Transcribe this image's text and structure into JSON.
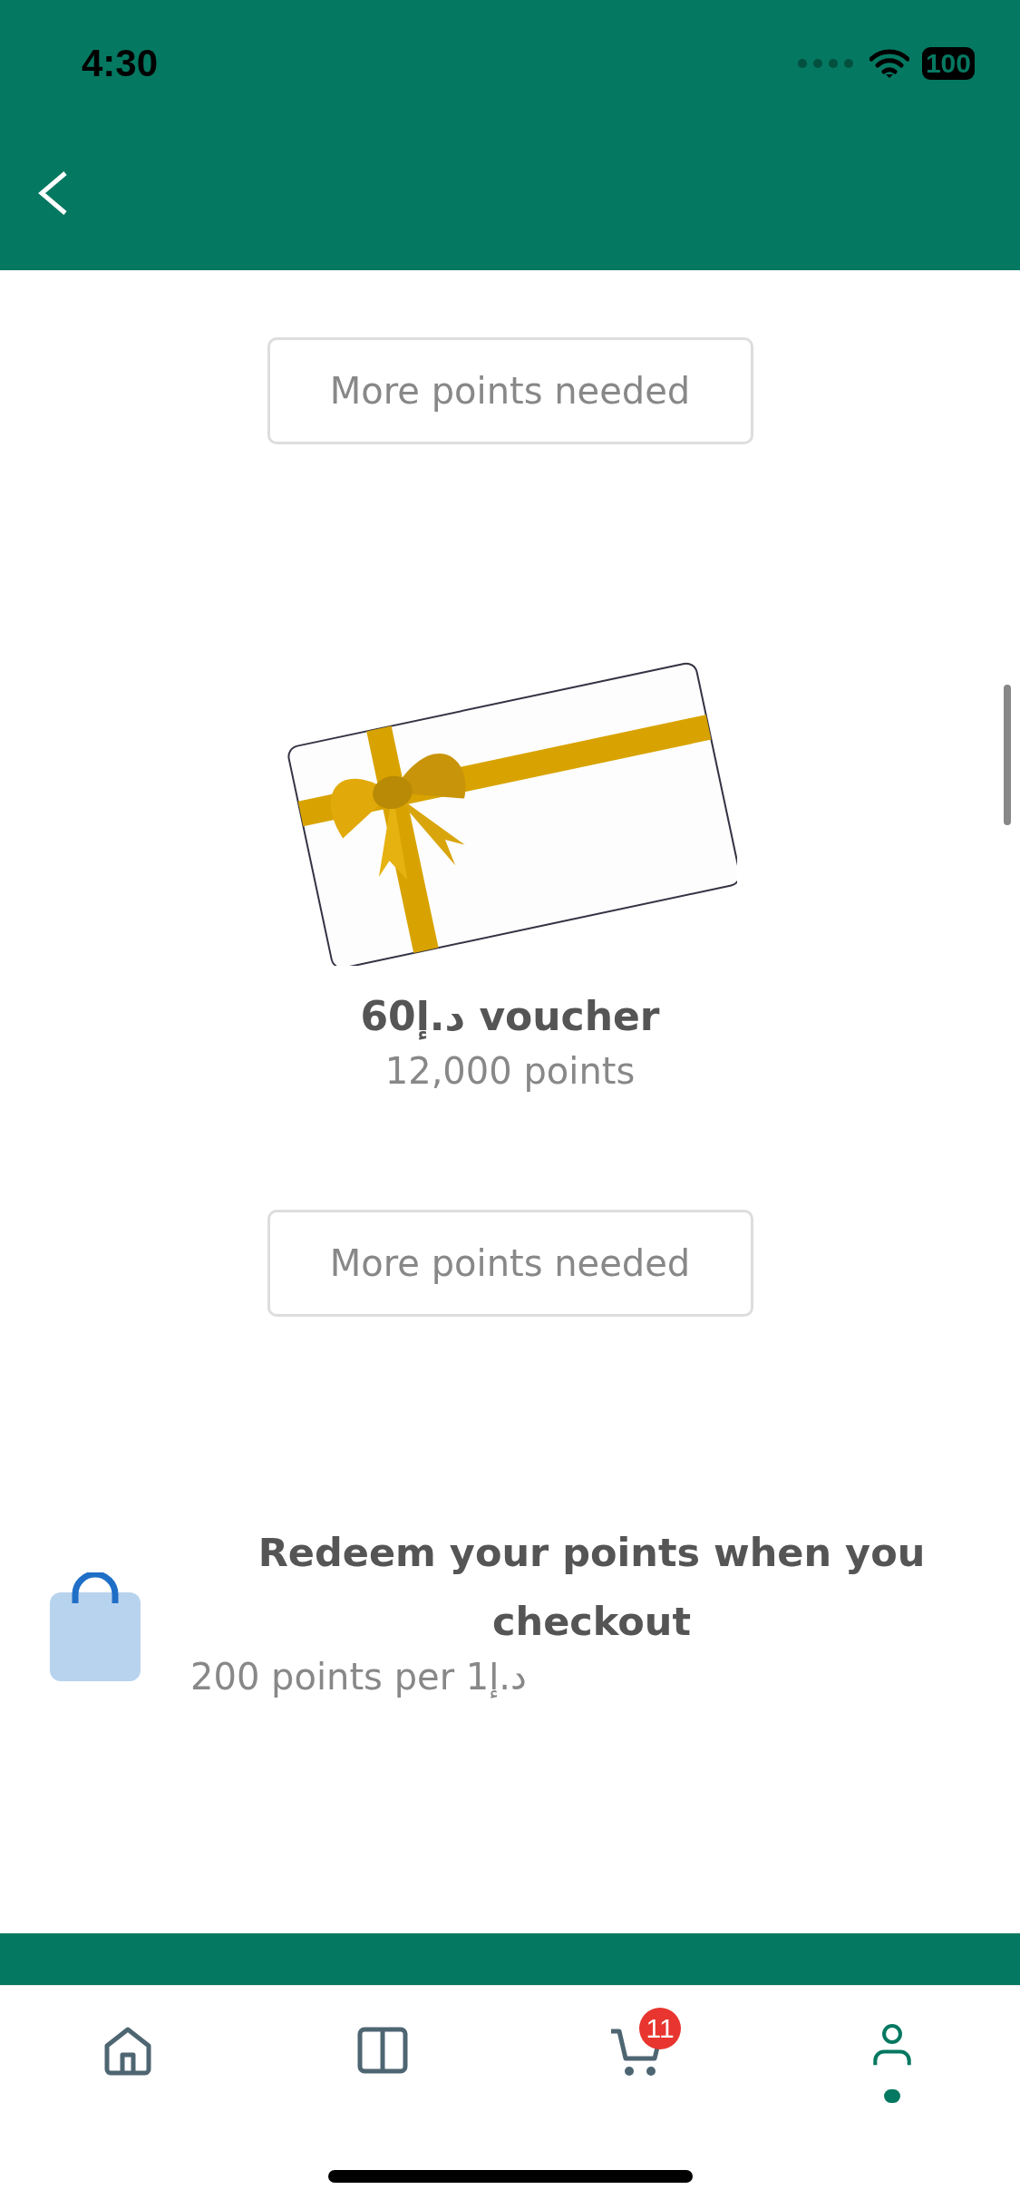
{
  "status_bar": {
    "time": "4:30",
    "battery": "100"
  },
  "rewards": [
    {
      "kind": "button",
      "label": "More points needed",
      "disabled": true
    },
    {
      "kind": "voucher",
      "title": "60د.إ voucher",
      "points": "12,000 points"
    },
    {
      "kind": "button",
      "label": "More points needed",
      "disabled": true
    },
    {
      "kind": "info",
      "title": "Redeem your points when you checkout",
      "subtitle": "200 points per 1د.إ"
    }
  ],
  "tab_bar": [
    {
      "kind": "home",
      "selected": false
    },
    {
      "kind": "columns",
      "selected": false
    },
    {
      "kind": "cart",
      "selected": false,
      "badge": "11"
    },
    {
      "kind": "person",
      "selected": true
    }
  ]
}
